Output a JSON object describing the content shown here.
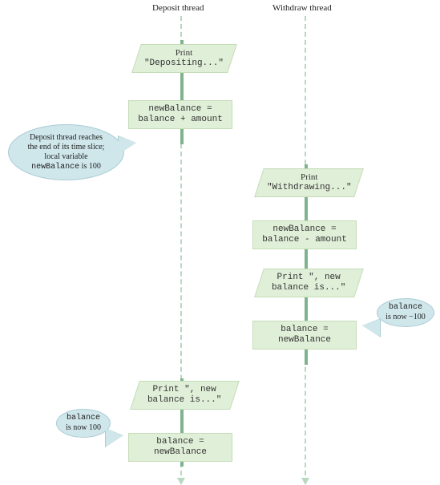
{
  "lanes": {
    "deposit_label": "Deposit thread",
    "withdraw_label": "Withdraw thread"
  },
  "nodes": {
    "d1_l1": "Print",
    "d1_l2": "\"Depositing...\"",
    "d2_l1": "newBalance =",
    "d2_l2": "balance + amount",
    "w1_l1": "Print",
    "w1_l2": "\"Withdrawing...\"",
    "w2_l1": "newBalance =",
    "w2_l2": "balance - amount",
    "w3_l1": "Print \", new",
    "w3_l2": "balance is...\"",
    "w4_l1": "balance =",
    "w4_l2": "newBalance",
    "d3_l1": "Print \", new",
    "d3_l2": "balance is...\"",
    "d4_l1": "balance =",
    "d4_l2": "newBalance"
  },
  "callouts": {
    "c1_l1": "Deposit thread reaches",
    "c1_l2": "the end of its time slice;",
    "c1_l3": "local variable",
    "c1_var": "newBalance",
    "c1_l4": " is 100",
    "c2_l1": "balance",
    "c2_l2": "is now −100",
    "c3_l1": "balance",
    "c3_l2": "is now 100"
  },
  "chart_data": {
    "type": "table",
    "description": "Sequence / flowchart of two threads (Deposit thread and Withdraw thread) racing on a shared balance variable.",
    "lanes": [
      "Deposit thread",
      "Withdraw thread"
    ],
    "steps": [
      {
        "lane": "Deposit thread",
        "shape": "io",
        "text": "Print \"Depositing...\""
      },
      {
        "lane": "Deposit thread",
        "shape": "process",
        "text": "newBalance = balance + amount",
        "annotation": "Deposit thread reaches the end of its time slice; local variable newBalance is 100"
      },
      {
        "lane": "Withdraw thread",
        "shape": "io",
        "text": "Print \"Withdrawing...\""
      },
      {
        "lane": "Withdraw thread",
        "shape": "process",
        "text": "newBalance = balance - amount"
      },
      {
        "lane": "Withdraw thread",
        "shape": "io",
        "text": "Print \", new balance is...\""
      },
      {
        "lane": "Withdraw thread",
        "shape": "process",
        "text": "balance = newBalance",
        "annotation": "balance is now -100"
      },
      {
        "lane": "Deposit thread",
        "shape": "io",
        "text": "Print \", new balance is...\""
      },
      {
        "lane": "Deposit thread",
        "shape": "process",
        "text": "balance = newBalance",
        "annotation": "balance is now 100"
      }
    ]
  }
}
